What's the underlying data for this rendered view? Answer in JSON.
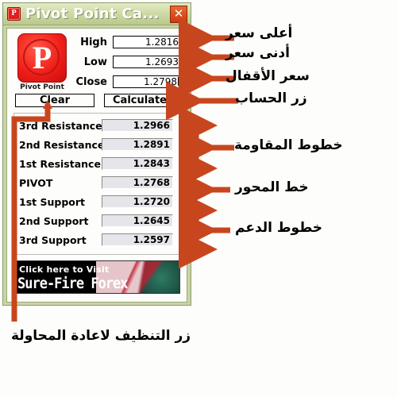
{
  "window": {
    "title": "Pivot Point Ca...",
    "app_icon": "P",
    "close_label": "✕",
    "icon_name": "pivot-point-app-icon"
  },
  "logo": {
    "letter": "P",
    "caption": "Pivot Point"
  },
  "inputs": [
    {
      "label": "High",
      "value": "1.2816",
      "caret": false
    },
    {
      "label": "Low",
      "value": "1.2693",
      "caret": false
    },
    {
      "label": "Close",
      "value": "1.2798",
      "caret": true
    }
  ],
  "buttons": {
    "clear": "Clear",
    "calculate": "Calculate"
  },
  "results": [
    {
      "label": "3rd Resistance",
      "value": "1.2966"
    },
    {
      "label": "2nd Resistance",
      "value": "1.2891"
    },
    {
      "label": "1st Resistance",
      "value": "1.2843"
    },
    {
      "label": "PIVOT",
      "value": "1.2768"
    },
    {
      "label": "1st Support",
      "value": "1.2720"
    },
    {
      "label": "2nd Support",
      "value": "1.2645"
    },
    {
      "label": "3rd Support",
      "value": "1.2597"
    }
  ],
  "banner": {
    "line1": "Click here to Visit",
    "line2": "Sure-Fire Forex Trading"
  },
  "annotations": {
    "high": "أعلى سعر",
    "low": "أدنى سعر",
    "close": "سعر الأقفال",
    "calculate": "زر الحساب",
    "resistance": "خطوط المقاومة",
    "pivot": "خط المحور",
    "support": "خطوط الدعم",
    "clear": "زر التنظيف لاعادة المحاولة"
  },
  "colors": {
    "annotation_arrow": "#c8461e",
    "titlebar_green": "#cfdba7",
    "logo_red": "#e8201b",
    "result_field": "#e6e6ea"
  }
}
